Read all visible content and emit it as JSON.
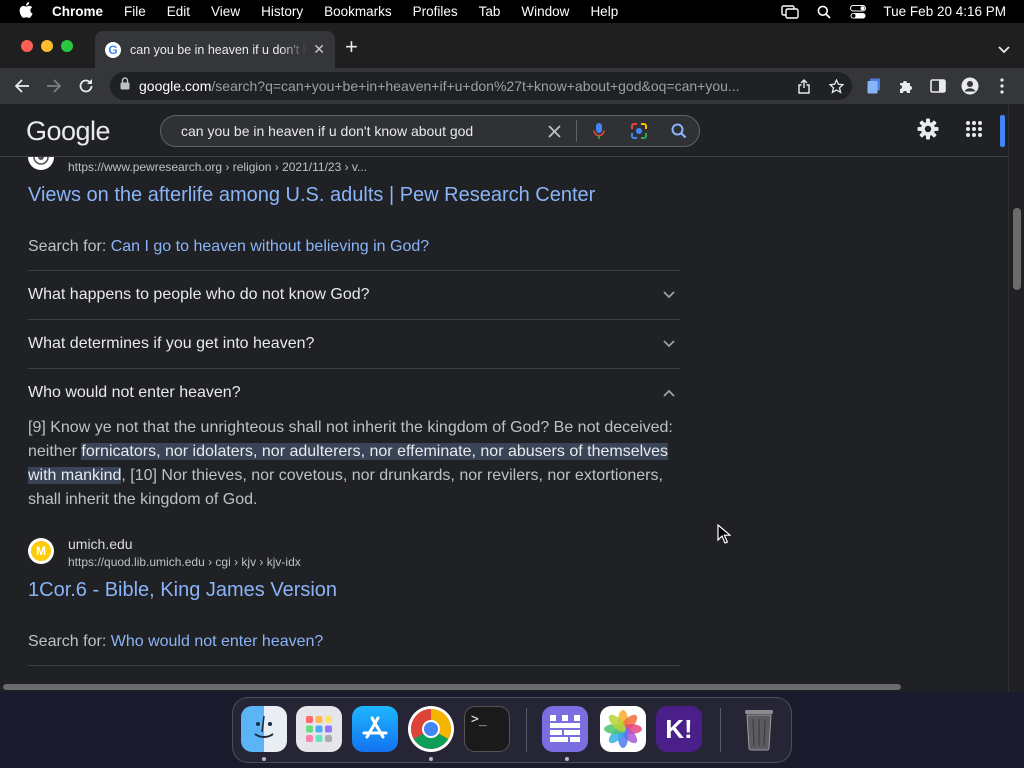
{
  "menubar": {
    "items": [
      "Chrome",
      "File",
      "Edit",
      "View",
      "History",
      "Bookmarks",
      "Profiles",
      "Tab",
      "Window",
      "Help"
    ],
    "clock": "Tue Feb 20  4:16 PM"
  },
  "tab": {
    "title": "can you be in heaven if u don't know about god - Google Search"
  },
  "omnibox": {
    "domain": "google.com",
    "path": "/search?q=can+you+be+in+heaven+if+u+don%27t+know+about+god&oq=can+you..."
  },
  "google": {
    "logo": "Google",
    "query": "can you be in heaven if u don't know about god"
  },
  "results": {
    "pew": {
      "cite": "https://www.pewresearch.org › religion › 2021/11/23 › v...",
      "title": "Views on the afterlife among U.S. adults | Pew Research Center",
      "search_for_label": "Search for:",
      "search_for_link": "Can I go to heaven without believing in God?"
    },
    "questions": [
      {
        "text": "What happens to people who do not know God?",
        "expanded": false
      },
      {
        "text": "What determines if you get into heaven?",
        "expanded": false
      },
      {
        "text": "Who would not enter heaven?",
        "expanded": true
      }
    ],
    "answer": {
      "before": "[9] Know ye not that the unrighteous shall not inherit the kingdom of God? Be not deceived: neither ",
      "highlight": "fornicators, nor idolaters, nor adulterers, nor effeminate, nor abusers of themselves with mankind",
      "after": ", [10] Nor thieves, nor covetous, nor drunkards, nor revilers, nor extortioners, shall inherit the kingdom of God."
    },
    "umich": {
      "site": "umich.edu",
      "cite": "https://quod.lib.umich.edu › cgi › kjv › kjv-idx",
      "title": "1Cor.6 - Bible, King James Version",
      "search_for_label": "Search for:",
      "search_for_link": "Who would not enter heaven?"
    }
  },
  "dock": {
    "apps": [
      "finder-icon",
      "launchpad-icon",
      "app-store-icon",
      "chrome-icon",
      "terminal-icon",
      "wall-app-icon",
      "photos-icon",
      "klack-icon",
      "trash-icon"
    ],
    "terminal_glyph": ">_",
    "klack_glyph": "K!"
  },
  "colors": {
    "link": "#8ab4f8",
    "page_bg": "#202124",
    "highlight": "#394457"
  }
}
